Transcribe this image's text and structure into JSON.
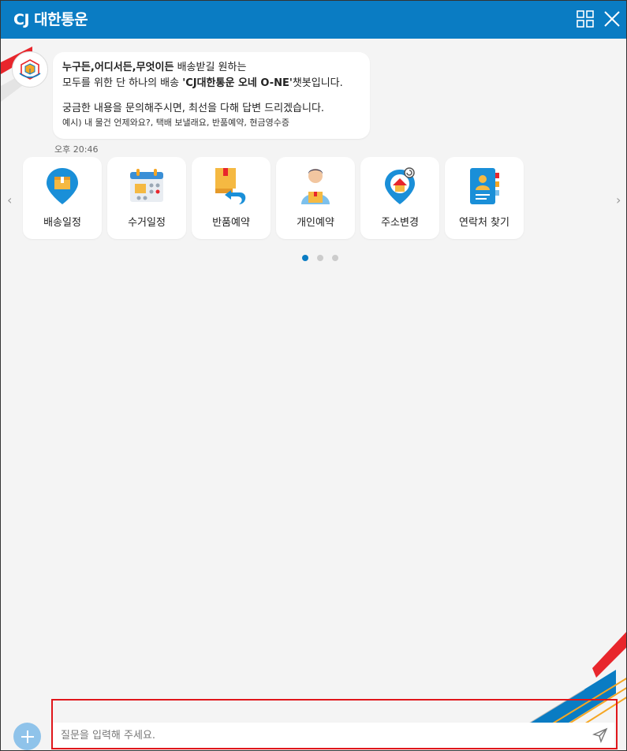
{
  "header": {
    "title": "CJ 대한통운"
  },
  "chat": {
    "message": {
      "line1_bold": "누구든,어디서든,무엇이든",
      "line1_rest": " 배송받길 원하는",
      "line2_pre": "모두를 위한 단 하나의 배송 ",
      "line2_bold": "'CJ대한통운 오네 O-NE'",
      "line2_post": "챗봇입니다.",
      "line3": "궁금한 내용을 문의해주시면, 최선을 다해 답변 드리겠습니다.",
      "example": "예시) 내 물건 언제와요?, 택배 보낼래요, 반품예약, 현금영수증"
    },
    "timestamp": "오후 20:46"
  },
  "quick_menu": {
    "prev_arrow": "‹",
    "next_arrow": "›",
    "items": [
      {
        "label": "배송일정",
        "icon": "delivery-location-icon"
      },
      {
        "label": "수거일정",
        "icon": "calendar-icon"
      },
      {
        "label": "반품예약",
        "icon": "return-package-icon"
      },
      {
        "label": "개인예약",
        "icon": "person-package-icon"
      },
      {
        "label": "주소변경",
        "icon": "address-home-icon"
      },
      {
        "label": "연락처 찾기",
        "icon": "contact-book-icon"
      }
    ],
    "pages": 3,
    "active_page": 1
  },
  "input": {
    "placeholder": "질문을 입력해 주세요.",
    "value": ""
  },
  "colors": {
    "brand": "#0a7cc3",
    "highlight": "#e0161b",
    "accent_red": "#e8262c",
    "accent_orange": "#f5a623"
  }
}
